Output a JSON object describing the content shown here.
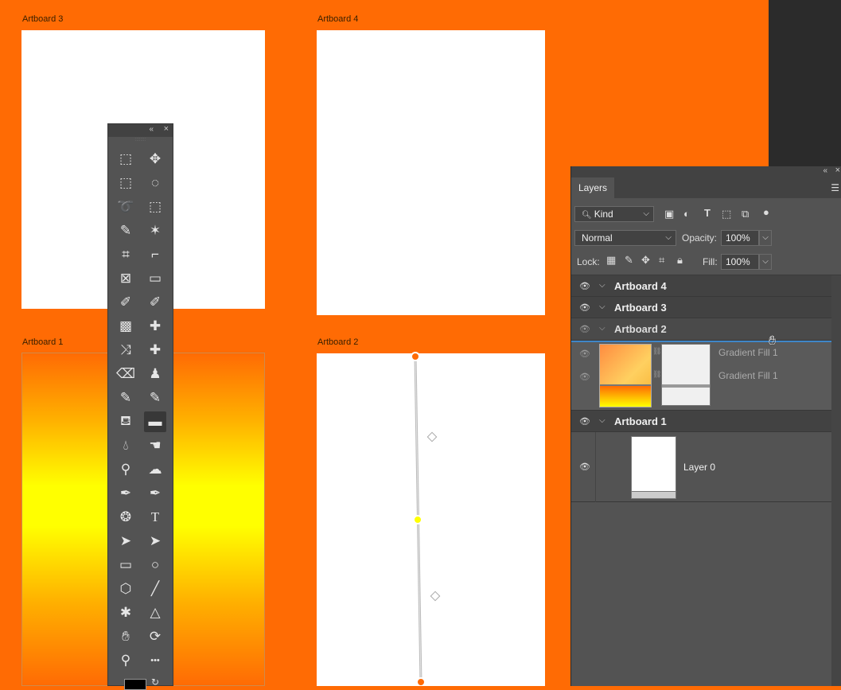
{
  "artboards": {
    "ab3": "Artboard 3",
    "ab4": "Artboard 4",
    "ab1": "Artboard 1",
    "ab2": "Artboard 2"
  },
  "colors": {
    "canvas_bg": "#ff6b04",
    "gradient_top": "#ff6b04",
    "gradient_mid": "#ffff00",
    "panel_bg": "#535353",
    "panel_dark": "#424242"
  },
  "tools": {
    "icons": [
      "artboard-tool-icon",
      "move-tool-icon",
      "rect-marquee-icon",
      "ellipse-marquee-icon",
      "lasso-icon",
      "object-select-icon",
      "quick-select-icon",
      "magic-wand-icon",
      "perspective-crop-icon",
      "crop-icon",
      "frame-icon",
      "ruler-icon",
      "color-sampler-icon",
      "eyedropper-icon",
      "spot-heal-icon",
      "healing-brush-icon",
      "content-aware-move-icon",
      "patch-icon",
      "eraser-icon",
      "clone-stamp-icon",
      "history-brush-icon",
      "brush-icon",
      "paint-bucket-icon",
      "gradient-icon",
      "blur-icon",
      "smudge-icon",
      "dodge-icon",
      "sponge-icon",
      "freeform-pen-icon",
      "pen-icon",
      "3d-icon",
      "type-icon",
      "path-select-icon",
      "direct-select-icon",
      "rectangle-icon",
      "ellipse-icon",
      "polygon-icon",
      "line-icon",
      "custom-shape-icon",
      "triangle-icon",
      "hand-icon",
      "rotate-view-icon",
      "zoom-icon",
      "more-icon"
    ]
  },
  "layers_panel": {
    "tab": "Layers",
    "filter_kind": "Kind",
    "blend_mode": "Normal",
    "opacity_label": "Opacity:",
    "opacity_value": "100%",
    "lock_label": "Lock:",
    "fill_label": "Fill:",
    "fill_value": "100%",
    "rows": {
      "ab4": "Artboard 4",
      "ab3": "Artboard 3",
      "ab2": "Artboard 2",
      "gf1a": "Gradient Fill 1",
      "gf1b": "Gradient Fill 1",
      "ab1": "Artboard 1",
      "layer0": "Layer 0"
    }
  }
}
